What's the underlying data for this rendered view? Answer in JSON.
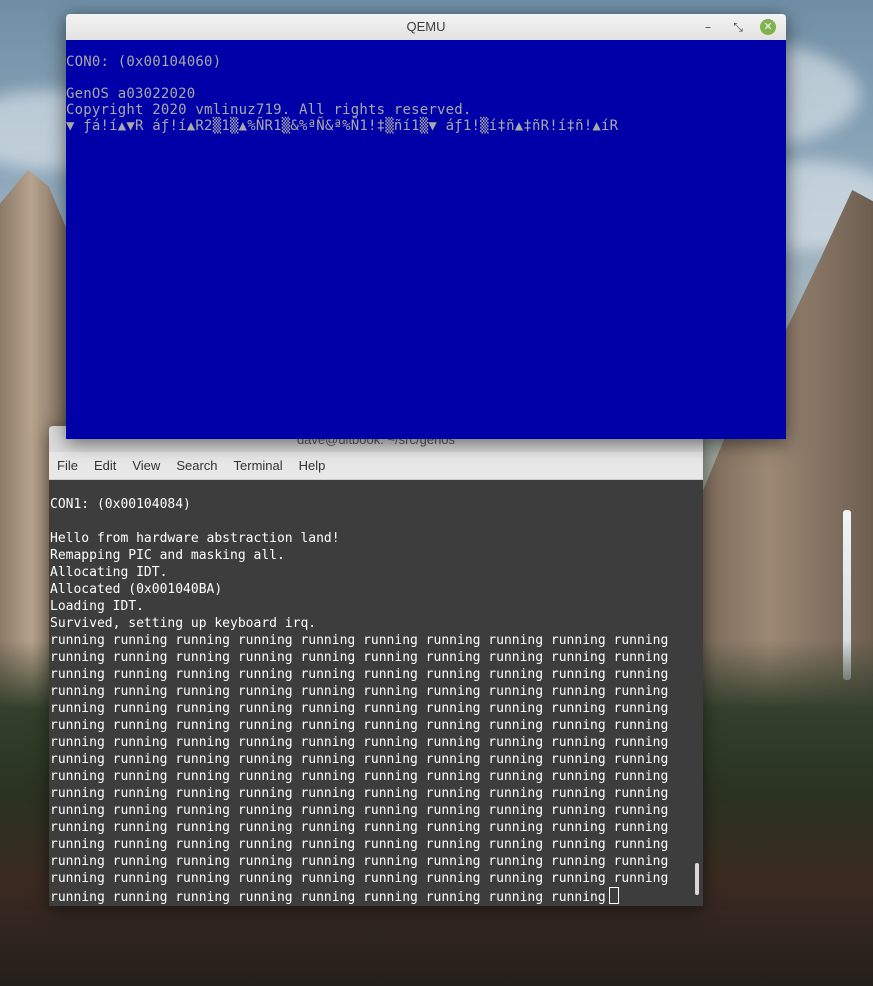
{
  "qemu": {
    "title": "QEMU",
    "controls": {
      "minimize": "–",
      "restore": "⤡",
      "close": "✕"
    },
    "screen_lines": [
      "CON0: (0x00104060)",
      "",
      "GenOS a03022020",
      "Copyright 2020 vmlinuz719. All rights reserved.",
      "▼ ƒá!í▲▼R áƒ!í▲R2▒1▒▲%ÑR1▒&%ªÑ&ª%Ñ1!‡▒ñí1▒▼ áƒ1!▒í‡ñ▲‡ñR!í‡ñ!▲íR"
    ]
  },
  "terminal": {
    "title": "dave@ultbook: ~/src/genos",
    "menu": [
      "File",
      "Edit",
      "View",
      "Search",
      "Terminal",
      "Help"
    ],
    "intro_lines": [
      "CON1: (0x00104084)",
      "",
      "Hello from hardware abstraction land!",
      "Remapping PIC and masking all.",
      "Allocating IDT.",
      "Allocated (0x001040BA)",
      "Loading IDT.",
      "Survived, setting up keyboard irq."
    ],
    "running_lines": [
      "running running running running running running running running running running",
      "running running running running running running running running running running",
      "running running running running running running running running running running",
      "running running running running running running running running running running",
      "running running running running running running running running running running",
      "running running running running running running running running running running",
      "running running running running running running running running running running",
      "running running running running running running running running running running",
      "running running running running running running running running running running",
      "running running running running running running running running running running",
      "running running running running running running running running running running",
      "running running running running running running running running running running",
      "running running running running running running running running running running",
      "running running running running running running running running running running",
      "running running running running running running running running running running"
    ],
    "last_line": "running running running running running running running running running"
  },
  "colors": {
    "qemu_background": "#0000a8",
    "qemu_text": "#a9a9a9",
    "terminal_background": "#3d3d3d",
    "terminal_text": "#ffffff"
  }
}
